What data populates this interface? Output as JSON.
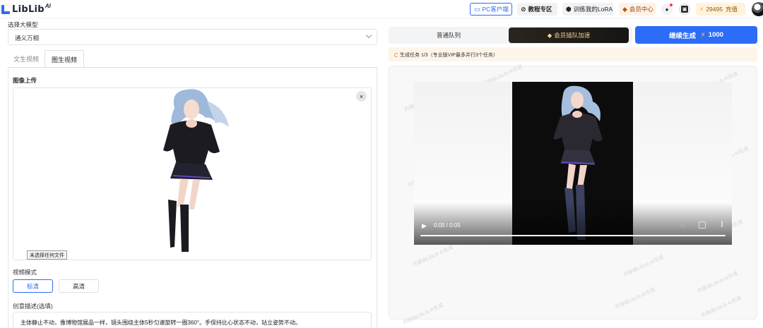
{
  "header": {
    "logo_text": "LibLib",
    "logo_sup": "AI",
    "pc_client": "PC客户端",
    "tutorial": "教程专区",
    "train_lora": "训练我的LoRA",
    "vip_center": "会员中心",
    "points": "29495",
    "recharge": "充值"
  },
  "left": {
    "model_label": "选择大模型",
    "model_value": "通义万相",
    "tabs": [
      {
        "label": "文生视频",
        "active": false
      },
      {
        "label": "图生视频",
        "active": true
      }
    ],
    "upload_label": "图像上传",
    "close_glyph": "×",
    "file_input_label": "未选择任何文件",
    "video_mode_label": "视频模式",
    "modes": [
      {
        "label": "标清",
        "active": true
      },
      {
        "label": "高清",
        "active": false
      }
    ],
    "desc_label": "创意描述(选填)",
    "desc_value": "主体静止不动，像博物馆展品一样，镜头围绕主体5秒匀速旋转一圈360°。手保持比心状态不动，站立姿势不动。"
  },
  "right": {
    "queue_normal": "普通队列",
    "queue_vip": "会员插队加速",
    "generate_label": "继续生成",
    "generate_cost": "1000",
    "status_text": "生成任务 1/3（专业版VIP最多并行3个任务）",
    "watermark": "内容由LibLib AI生成",
    "video_time": "0:05 / 0:05"
  },
  "colors": {
    "accent": "#2c6cf6",
    "vip_gold": "#f3cf8c",
    "status_bg": "#fdf5ea"
  }
}
